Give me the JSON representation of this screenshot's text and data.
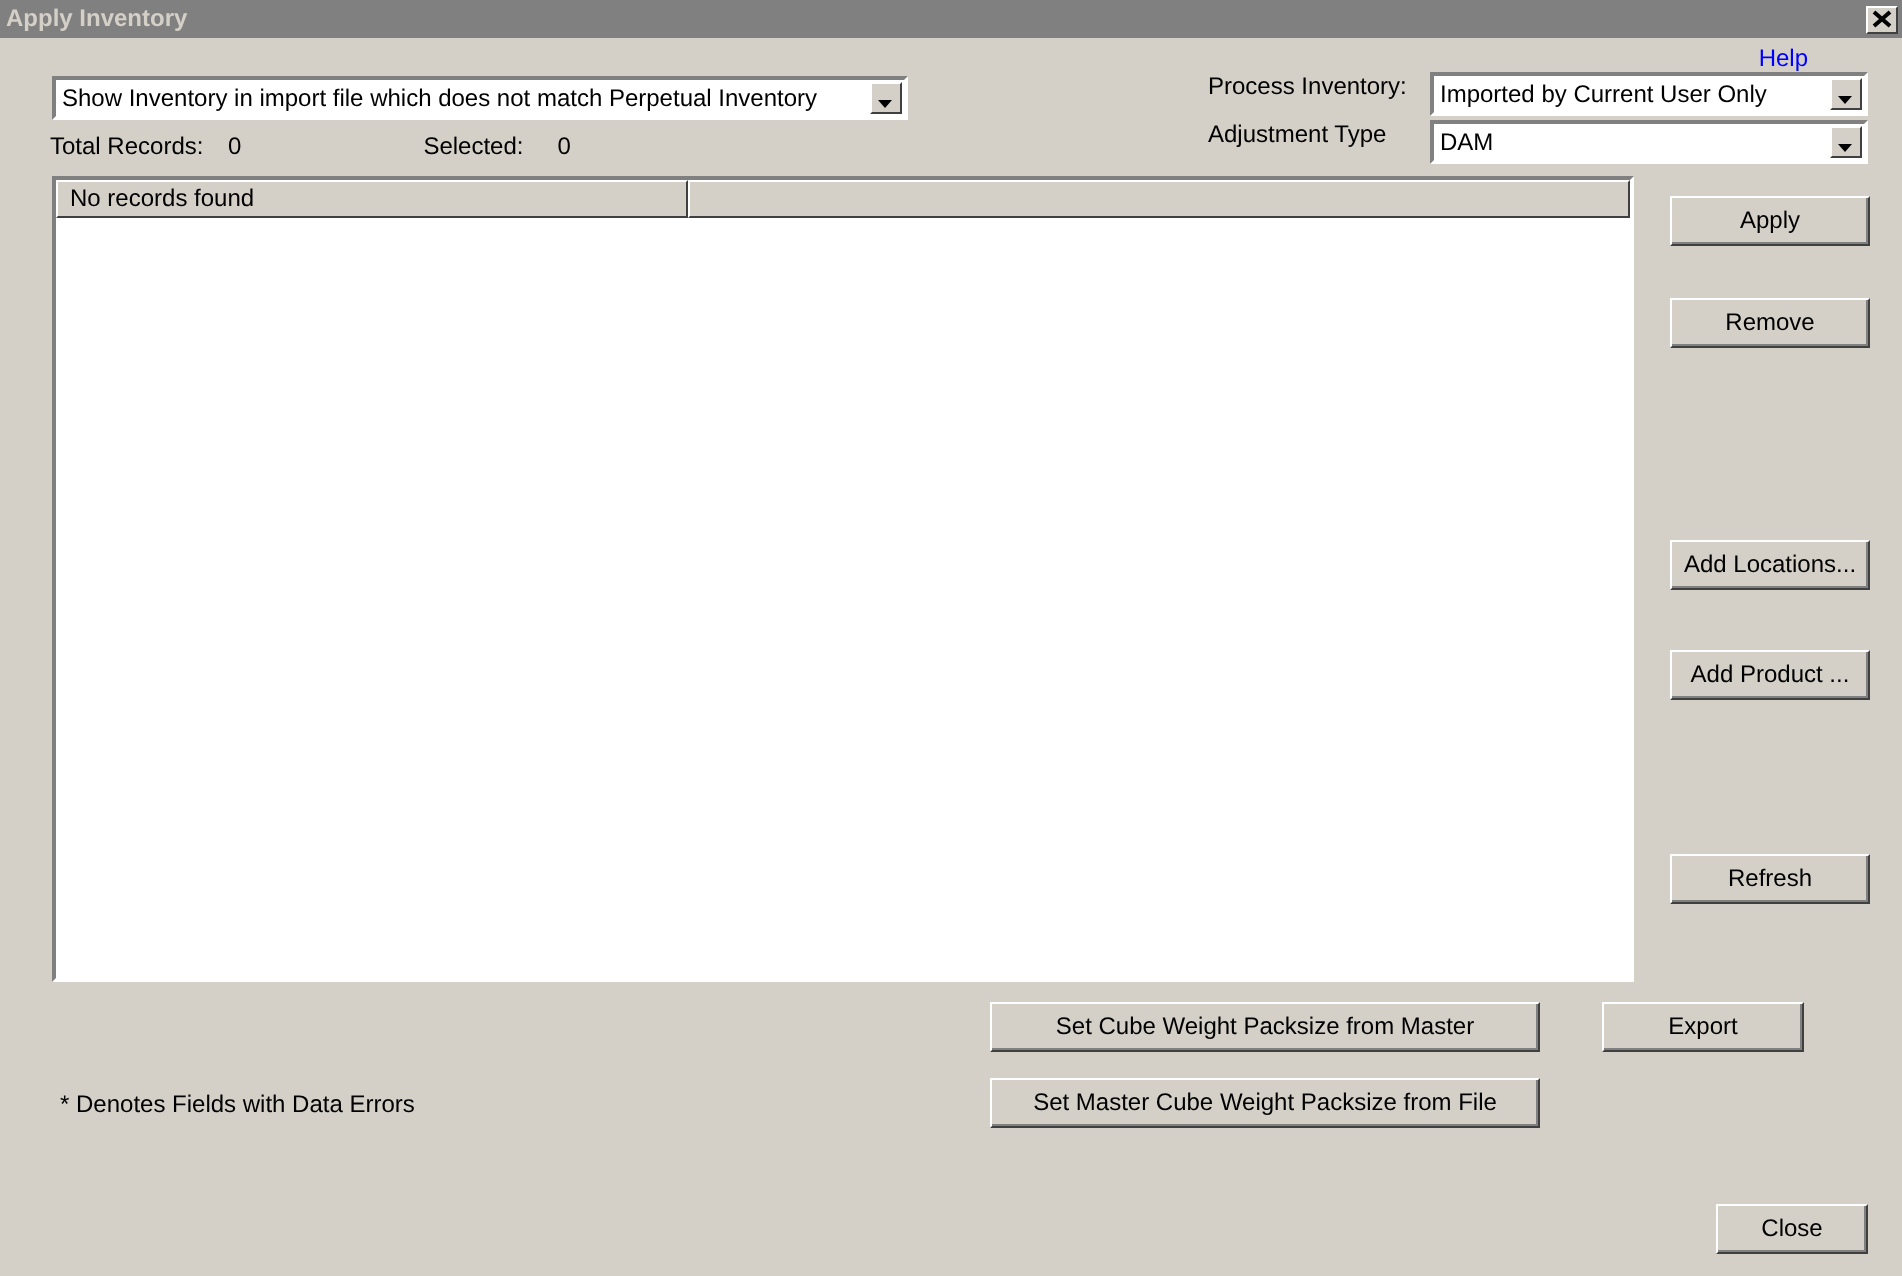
{
  "window": {
    "title": "Apply Inventory"
  },
  "help_link": "Help",
  "filter": {
    "value": "Show Inventory in import file which does not match Perpetual Inventory"
  },
  "totals": [
    {
      "label": "Total Records:",
      "value": "0"
    },
    {
      "label": "Selected:",
      "value": "0"
    }
  ],
  "process_inventory": {
    "label": "Process Inventory:",
    "value": "Imported by Current User Only"
  },
  "adjustment_type": {
    "label": "Adjustment Type",
    "value": "DAM"
  },
  "table": {
    "columns": [
      {
        "label": "No records found"
      }
    ]
  },
  "side_buttons": [
    "Apply",
    "Remove",
    "Add Locations...",
    "Add Product ...",
    "Refresh"
  ],
  "bottom_buttons": [
    "Set Cube Weight Packsize from Master",
    "Set Master Cube Weight Packsize from File"
  ],
  "export_button": "Export",
  "note": "* Denotes Fields with Data Errors",
  "close_button": "Close"
}
